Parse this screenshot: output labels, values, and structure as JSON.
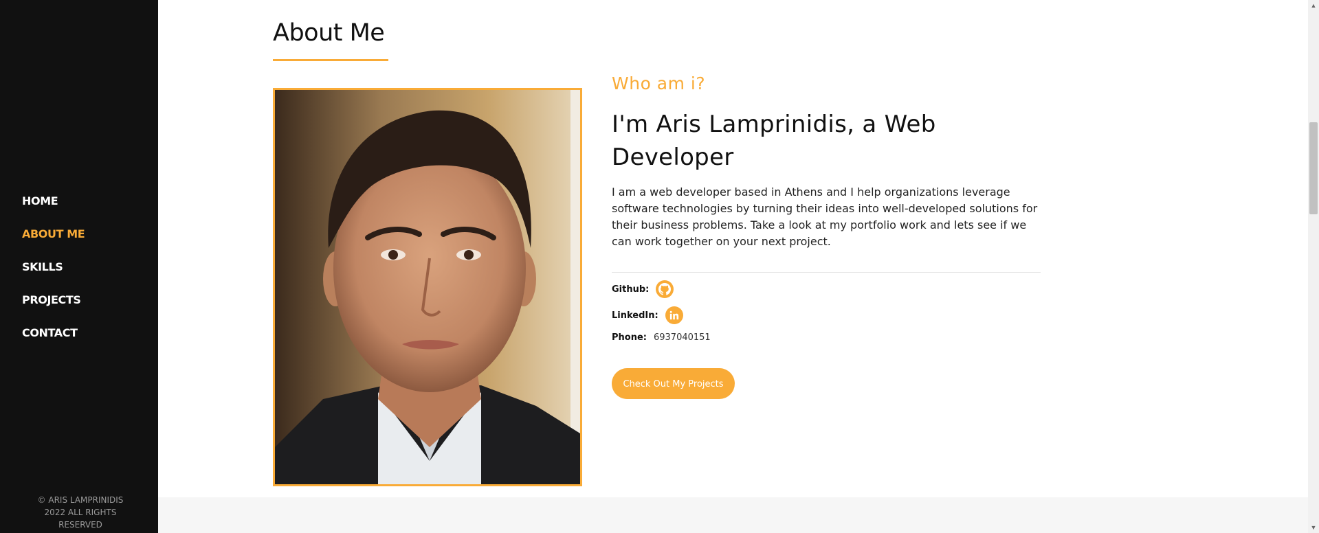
{
  "sidebar": {
    "nav": [
      {
        "label": "HOME",
        "active": false
      },
      {
        "label": "ABOUT ME",
        "active": true
      },
      {
        "label": "SKILLS",
        "active": false
      },
      {
        "label": "PROJECTS",
        "active": false
      },
      {
        "label": "CONTACT",
        "active": false
      }
    ],
    "footer_line1": "© ARIS LAMPRINIDIS",
    "footer_line2": "2022 ALL RIGHTS RESERVED"
  },
  "about": {
    "title": "About Me",
    "who_label": "Who am i?",
    "headline": "I'm Aris Lamprinidis, a Web Developer",
    "bio": "I am a web developer based in Athens and I help organizations leverage software technologies by turning their ideas into well-developed solutions for their business problems. Take a look at my portfolio work and lets see if we can work together on your next project.",
    "github_label": "Github:",
    "github_icon": "github-icon",
    "linkedin_label": "LinkedIn:",
    "linkedin_icon": "linkedin-icon",
    "phone_label": "Phone:",
    "phone_value": "6937040151",
    "cta_label": "Check Out My Projects"
  },
  "colors": {
    "accent": "#f9ab37",
    "sidebar_bg": "#111111"
  }
}
